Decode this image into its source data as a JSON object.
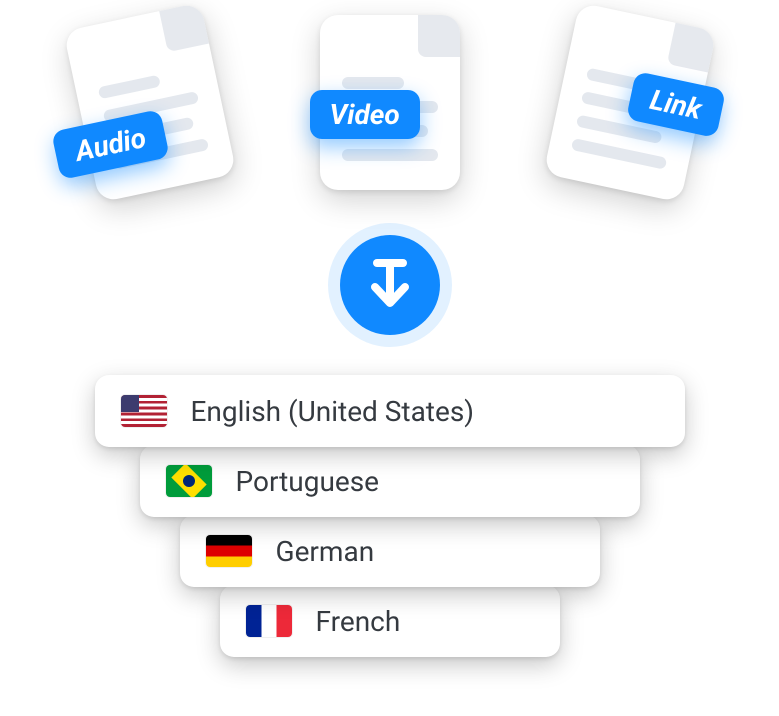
{
  "docs": {
    "audio": {
      "label": "Audio"
    },
    "video": {
      "label": "Video"
    },
    "link": {
      "label": "Link"
    }
  },
  "languages": [
    {
      "flag": "us",
      "label": "English (United States)"
    },
    {
      "flag": "br",
      "label": "Portuguese"
    },
    {
      "flag": "de",
      "label": "German"
    },
    {
      "flag": "fr",
      "label": "French"
    }
  ],
  "accent_color": "#1089ff"
}
